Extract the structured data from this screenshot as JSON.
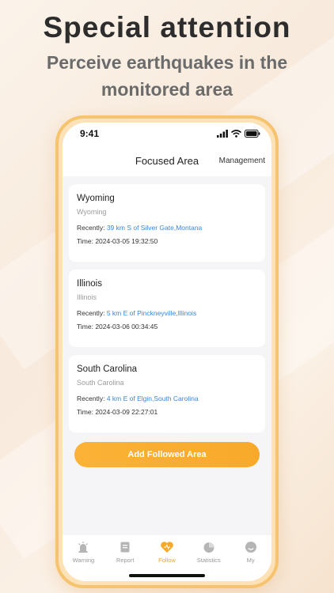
{
  "promo": {
    "headline": "Special attention",
    "subline": "Perceive earthquakes in the monitored area"
  },
  "status_bar": {
    "time": "9:41"
  },
  "nav": {
    "title": "Focused Area",
    "action": "Management"
  },
  "areas": [
    {
      "name": "Wyoming",
      "region": "Wyoming",
      "recent_label": "Recently:",
      "recent_value": "39 km S of Silver Gate,Montana",
      "time_label": "Time:",
      "time_value": "2024-03-05 19:32:50"
    },
    {
      "name": "Illinois",
      "region": "Illinois",
      "recent_label": "Recently:",
      "recent_value": "5 km E of Pinckneyville,Illinois",
      "time_label": "Time:",
      "time_value": "2024-03-06 00:34:45"
    },
    {
      "name": "South Carolina",
      "region": "South Carolina",
      "recent_label": "Recently:",
      "recent_value": "4 km E of Elgin,South Carolina",
      "time_label": "Time:",
      "time_value": "2024-03-09 22:27:01"
    }
  ],
  "add_button": "Add Followed Area",
  "tabs": [
    {
      "label": "Warning",
      "icon": "alarm-icon",
      "active": false
    },
    {
      "label": "Report",
      "icon": "report-icon",
      "active": false
    },
    {
      "label": "Follow",
      "icon": "heart-icon",
      "active": true
    },
    {
      "label": "Statistics",
      "icon": "pie-chart-icon",
      "active": false
    },
    {
      "label": "My",
      "icon": "profile-icon",
      "active": false
    }
  ],
  "colors": {
    "accent": "#f8a92a",
    "link": "#3b86d8",
    "inactive_tab": "#b5b5b5"
  }
}
